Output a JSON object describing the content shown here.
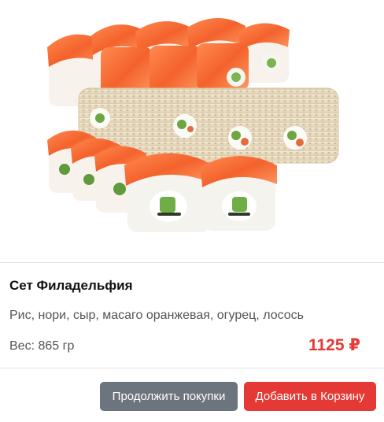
{
  "product": {
    "image_alt": "sushi-set-philadelphia",
    "title": "Сет Филадельфия",
    "ingredients": "Рис, нори, сыр, масаго оранжевая, огурец, лосось",
    "weight": "Вес: 865 гр",
    "price": "1125 ₽"
  },
  "actions": {
    "continue_label": "Продолжить покупки",
    "add_label": "Добавить в Корзину"
  },
  "colors": {
    "accent": "#e53935",
    "secondary": "#6c757d"
  }
}
